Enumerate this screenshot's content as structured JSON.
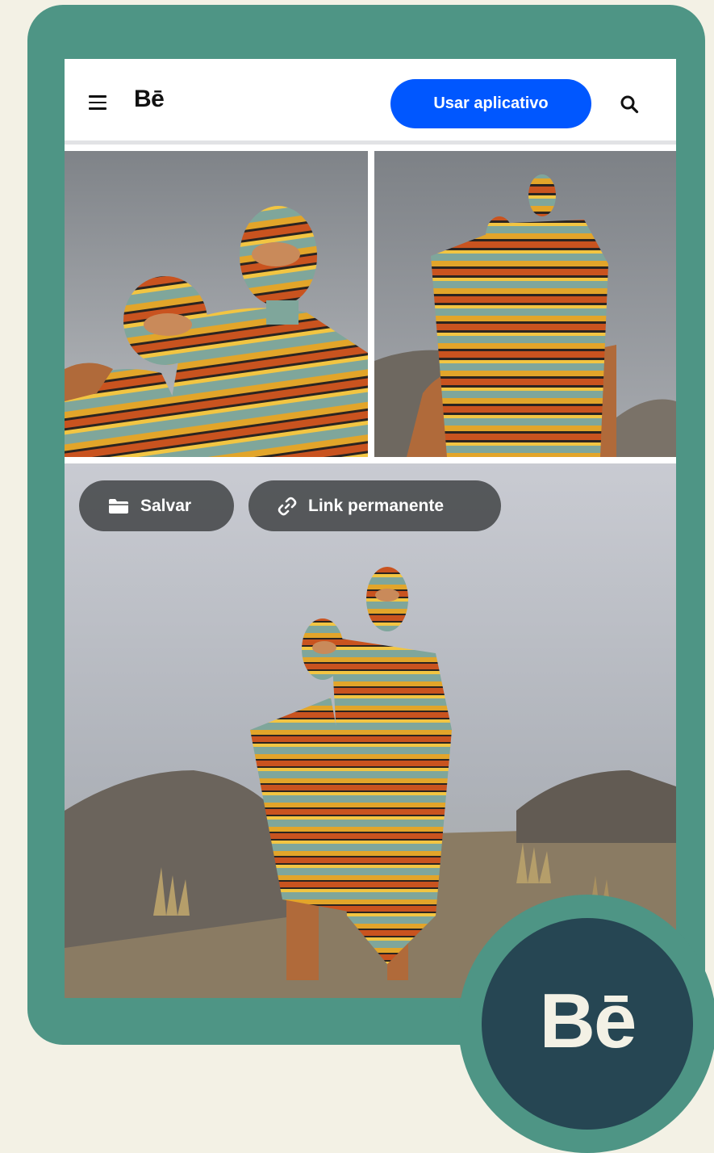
{
  "header": {
    "menu_icon": "hamburger-menu-icon",
    "logo": "Bē",
    "app_button_label": "Usar aplicativo",
    "search_icon": "search-icon"
  },
  "gallery": {
    "images": [
      {
        "name": "photo-couple-closeup"
      },
      {
        "name": "photo-couple-low-angle"
      },
      {
        "name": "photo-couple-desert-rocks"
      }
    ]
  },
  "overlay_actions": {
    "save_label": "Salvar",
    "save_icon": "folder-icon",
    "permalink_label": "Link permanente",
    "permalink_icon": "link-icon"
  },
  "badge": {
    "logo": "Bē"
  },
  "colors": {
    "background": "#f3f1e5",
    "frame": "#4e9585",
    "badge": "#264653",
    "accent_blue": "#0057ff"
  }
}
